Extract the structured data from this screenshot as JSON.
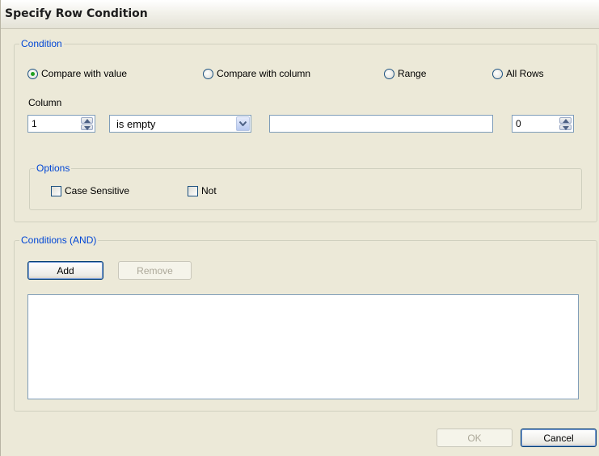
{
  "dialog": {
    "title": "Specify Row Condition"
  },
  "condition_group": {
    "legend": "Condition",
    "radios": [
      {
        "label": "Compare with value",
        "checked": true
      },
      {
        "label": "Compare with column",
        "checked": false
      },
      {
        "label": "Range",
        "checked": false
      },
      {
        "label": "All Rows",
        "checked": false
      }
    ],
    "column_label": "Column",
    "column_value": "1",
    "operator_value": "is empty",
    "compare_value": "",
    "range_value": "0"
  },
  "options_group": {
    "legend": "Options",
    "case_sensitive_label": "Case Sensitive",
    "case_sensitive_checked": false,
    "not_label": "Not",
    "not_checked": false
  },
  "conditions_group": {
    "legend": "Conditions (AND)",
    "add_label": "Add",
    "remove_label": "Remove",
    "items": []
  },
  "footer": {
    "ok_label": "OK",
    "cancel_label": "Cancel"
  },
  "icons": {
    "spinner": "up-down-spin-icon",
    "dropdown": "chevron-down-icon"
  }
}
